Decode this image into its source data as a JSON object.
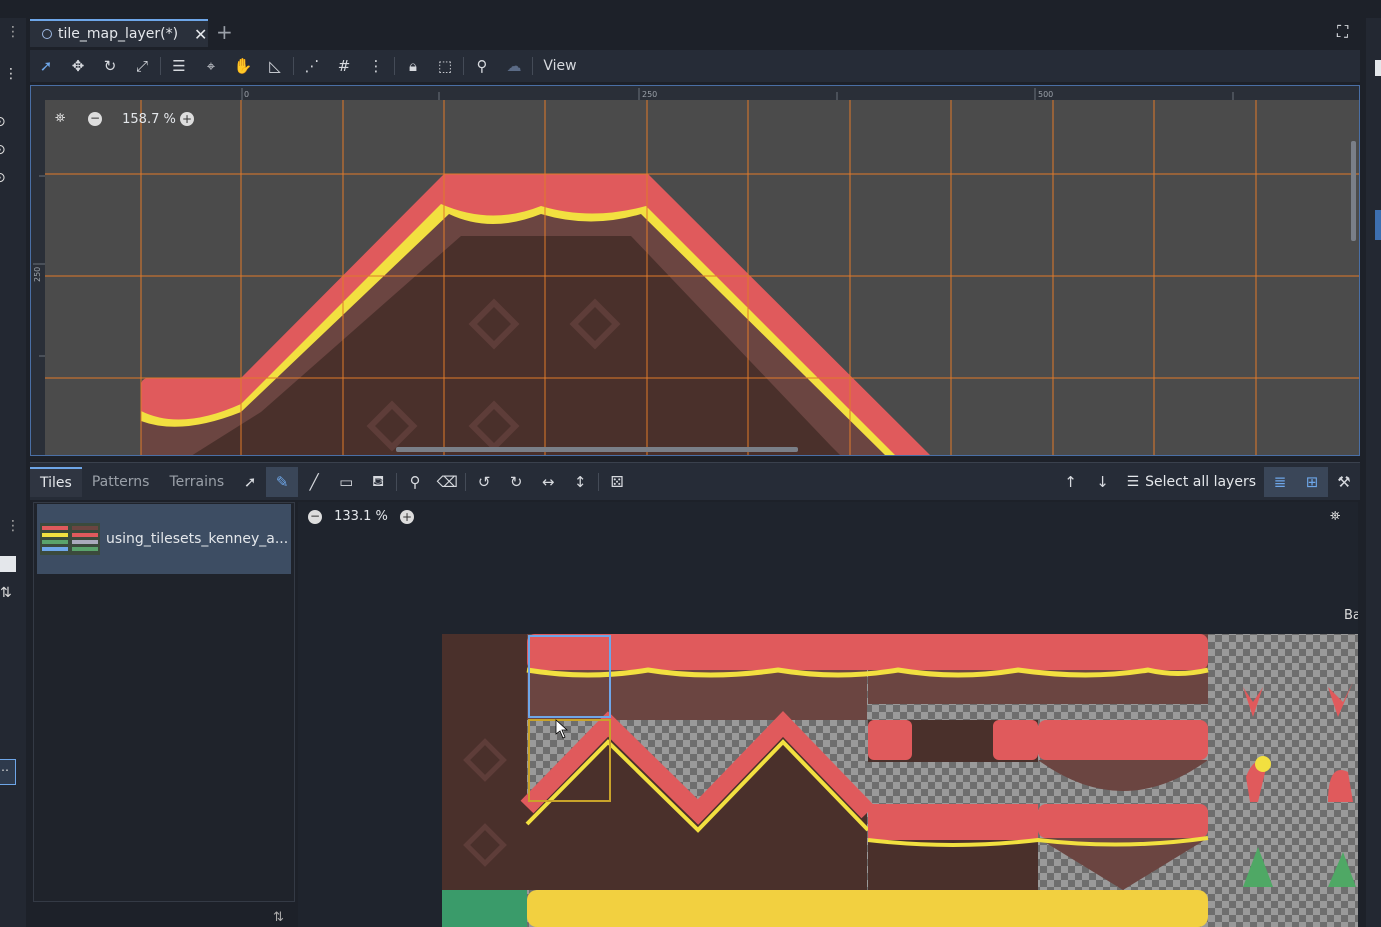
{
  "editor": {
    "scene_tab_label": "tile_map_layer(*)",
    "add_tab": "+",
    "close_tab": "✕",
    "view_menu": "View"
  },
  "viewport": {
    "zoom_label": "158.7 %",
    "ruler_h_labels": [
      "0",
      "250",
      "500"
    ],
    "ruler_v_labels": [
      "250"
    ]
  },
  "bottom_panel": {
    "tabs": [
      "Tiles",
      "Patterns",
      "Terrains"
    ],
    "select_all_layers": "Select all layers",
    "source_name": "using_tilesets_kenney_a...",
    "atlas_zoom_label": "133.1 %",
    "atlas_edge_text": "Ba"
  },
  "colors": {
    "accent": "#6ea6e8",
    "grid": "#e07a2a",
    "tile_red": "#e05a5c",
    "tile_yellow": "#f2e040",
    "tile_brown": "#4a302b",
    "tile_brown_light": "#6b4541"
  }
}
